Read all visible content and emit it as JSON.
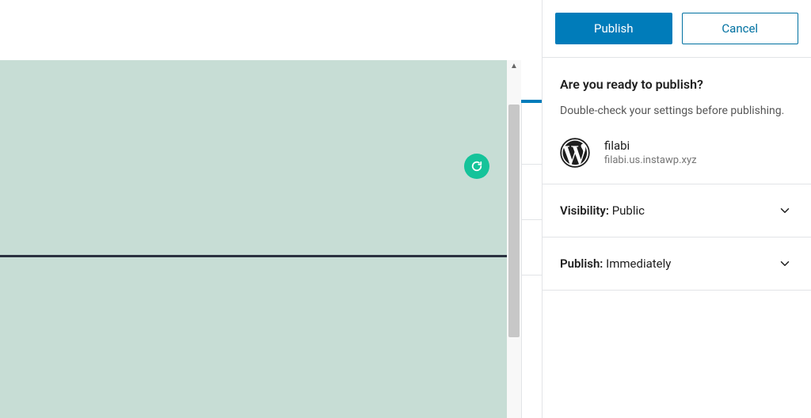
{
  "sidebar": {
    "actions": {
      "publish_label": "Publish",
      "cancel_label": "Cancel"
    },
    "prepublish": {
      "title": "Are you ready to publish?",
      "subtitle": "Double-check your settings before publishing.",
      "site_name": "filabi",
      "site_url": "filabi.us.instawp.xyz"
    },
    "visibility": {
      "label": "Visibility:",
      "value": "Public"
    },
    "schedule": {
      "label": "Publish:",
      "value": "Immediately"
    }
  },
  "icons": {
    "grammarly": "grammarly-icon",
    "wordpress": "wordpress-icon",
    "chevron_down": "chevron-down-icon",
    "scroll_up": "scroll-up-icon"
  }
}
